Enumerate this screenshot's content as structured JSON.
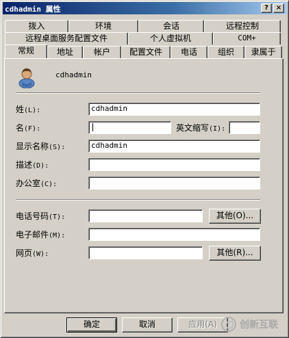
{
  "window": {
    "title": "cdhadmin 属性",
    "help_glyph": "?",
    "close_glyph": "×"
  },
  "tabs": {
    "row1": [
      "拨入",
      "环境",
      "会话",
      "远程控制"
    ],
    "row2": [
      "远程桌面服务配置文件",
      "个人虚拟机",
      "COM+"
    ],
    "row3": [
      "常规",
      "地址",
      "帐户",
      "配置文件",
      "电话",
      "组织",
      "隶属于"
    ],
    "active": "常规"
  },
  "general": {
    "user_name": "cdhadmin",
    "avatar_icon": "user-icon",
    "fields": {
      "last_name": {
        "label": "姓",
        "hotkey": "(L):",
        "value": "cdhadmin"
      },
      "first_name": {
        "label": "名",
        "hotkey": "(F):",
        "value": ""
      },
      "initials": {
        "label": "英文缩写",
        "hotkey": "(I):",
        "value": ""
      },
      "display_name": {
        "label": "显示名称",
        "hotkey": "(S):",
        "value": "cdhadmin"
      },
      "description": {
        "label": "描述",
        "hotkey": "(D):",
        "value": ""
      },
      "office": {
        "label": "办公室",
        "hotkey": "(C):",
        "value": ""
      },
      "phone": {
        "label": "电话号码",
        "hotkey": "(T):",
        "value": ""
      },
      "email": {
        "label": "电子邮件",
        "hotkey": "(M):",
        "value": ""
      },
      "webpage": {
        "label": "网页",
        "hotkey": "(W):",
        "value": ""
      }
    },
    "other_phone_button": "其他(O)...",
    "other_web_button": "其他(R)..."
  },
  "footer": {
    "ok": "确定",
    "cancel": "取消",
    "apply": "应用(A)"
  },
  "watermark": {
    "text": "创新互联"
  }
}
